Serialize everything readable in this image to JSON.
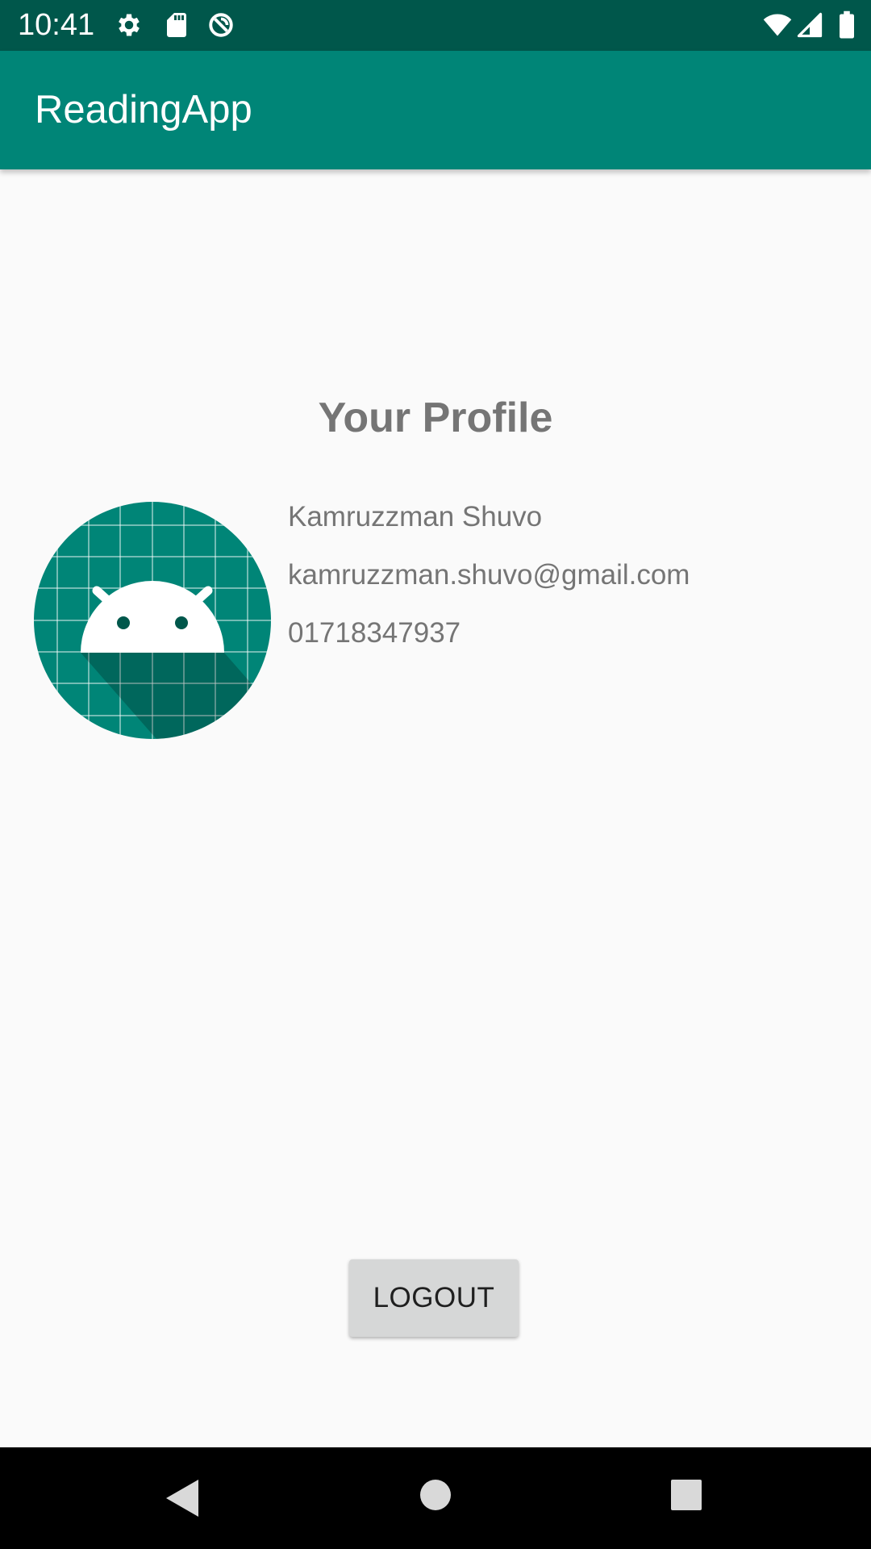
{
  "status_bar": {
    "time": "10:41",
    "icons": [
      "gear-icon",
      "sd-card-icon",
      "data-saver-icon",
      "wifi-icon",
      "cellular-signal-icon",
      "battery-icon"
    ]
  },
  "app_bar": {
    "title": "ReadingApp"
  },
  "profile": {
    "heading": "Your Profile",
    "avatar_icon": "android-robot-icon",
    "name": "Kamruzzman Shuvo",
    "email": "kamruzzman.shuvo@gmail.com",
    "phone": "01718347937"
  },
  "actions": {
    "logout_label": "LOGOUT"
  },
  "nav_bar": {
    "icons": [
      "back-icon",
      "home-icon",
      "recents-icon"
    ]
  },
  "colors": {
    "status_bar": "#00574b",
    "app_bar": "#008577",
    "background": "#fafafa",
    "text_gray": "#757575",
    "button_gray": "#d6d7d7"
  }
}
